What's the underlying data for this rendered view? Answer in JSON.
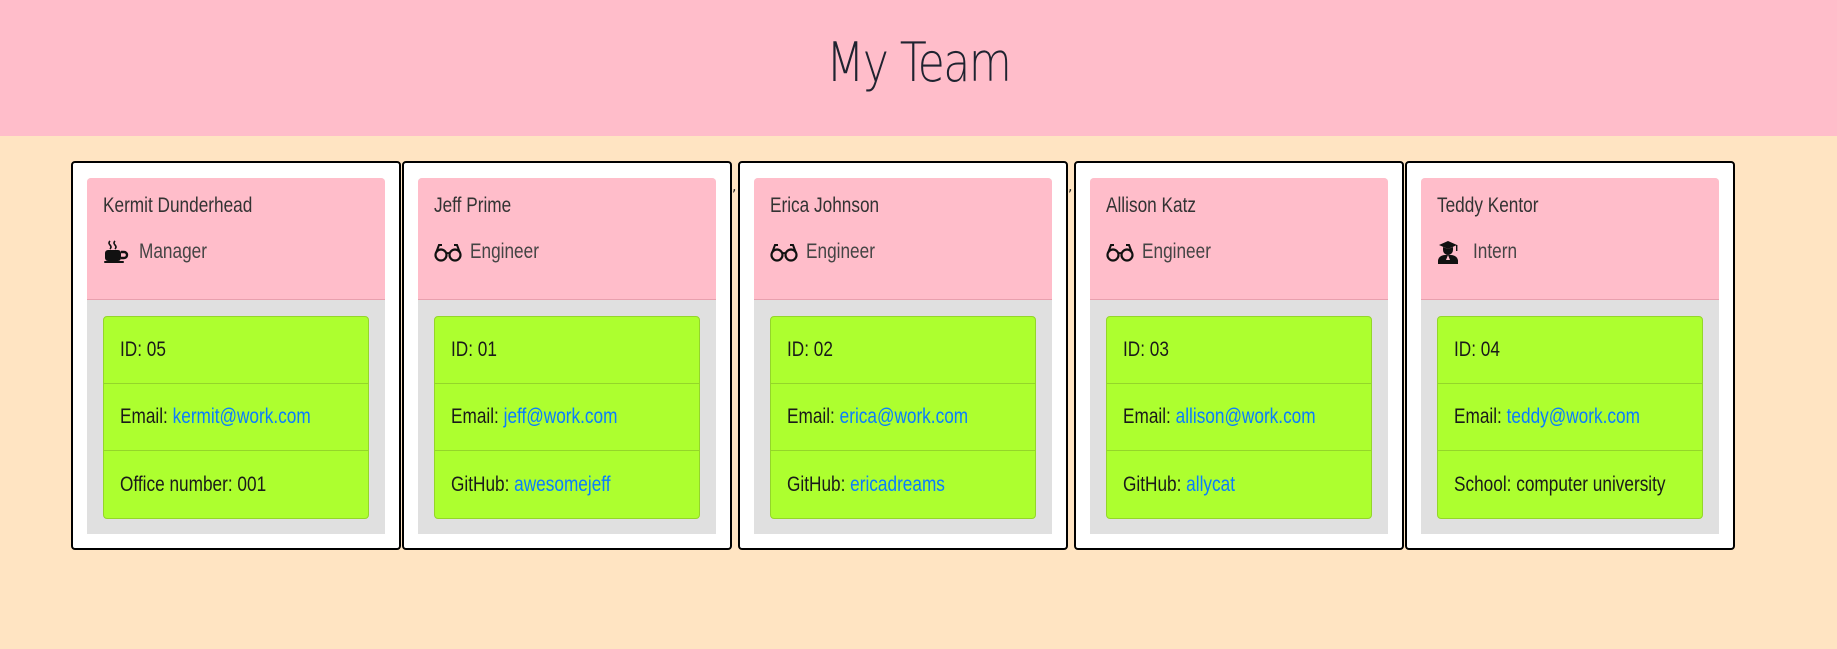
{
  "header": {
    "title": "My Team"
  },
  "team": [
    {
      "name": "Kermit Dunderhead",
      "role": "Manager",
      "icon": "coffee-icon",
      "id_label": "ID: ",
      "id": "05",
      "email_label": "Email: ",
      "email": "kermit@work.com",
      "extra_label": "Office number: ",
      "extra_value": "001"
    },
    {
      "name": "Jeff Prime",
      "role": "Engineer",
      "icon": "glasses-icon",
      "id_label": "ID: ",
      "id": "01",
      "email_label": "Email: ",
      "email": "jeff@work.com",
      "extra_label": "GitHub: ",
      "extra_value": "awesomejeff"
    },
    {
      "name": "Erica Johnson",
      "role": "Engineer",
      "icon": "glasses-icon",
      "id_label": "ID: ",
      "id": "02",
      "email_label": "Email: ",
      "email": "erica@work.com",
      "extra_label": "GitHub: ",
      "extra_value": "ericadreams"
    },
    {
      "name": "Allison Katz",
      "role": "Engineer",
      "icon": "glasses-icon",
      "id_label": "ID: ",
      "id": "03",
      "email_label": "Email: ",
      "email": "allison@work.com",
      "extra_label": "GitHub: ",
      "extra_value": "allycat"
    },
    {
      "name": "Teddy Kentor",
      "role": "Intern",
      "icon": "user-graduate-icon",
      "id_label": "ID: ",
      "id": "04",
      "email_label": "Email: ",
      "email": "teddy@work.com",
      "extra_label": "School: ",
      "extra_value": "computer university"
    }
  ],
  "stray_marks": [
    ",",
    ","
  ],
  "colors": {
    "page_background": "#ffe4c2",
    "header_background": "#ffbdca",
    "card_head_background": "#ffbdca",
    "card_body_background": "#e0e0e0",
    "info_background": "#adff2f",
    "link": "#0a7cff"
  }
}
